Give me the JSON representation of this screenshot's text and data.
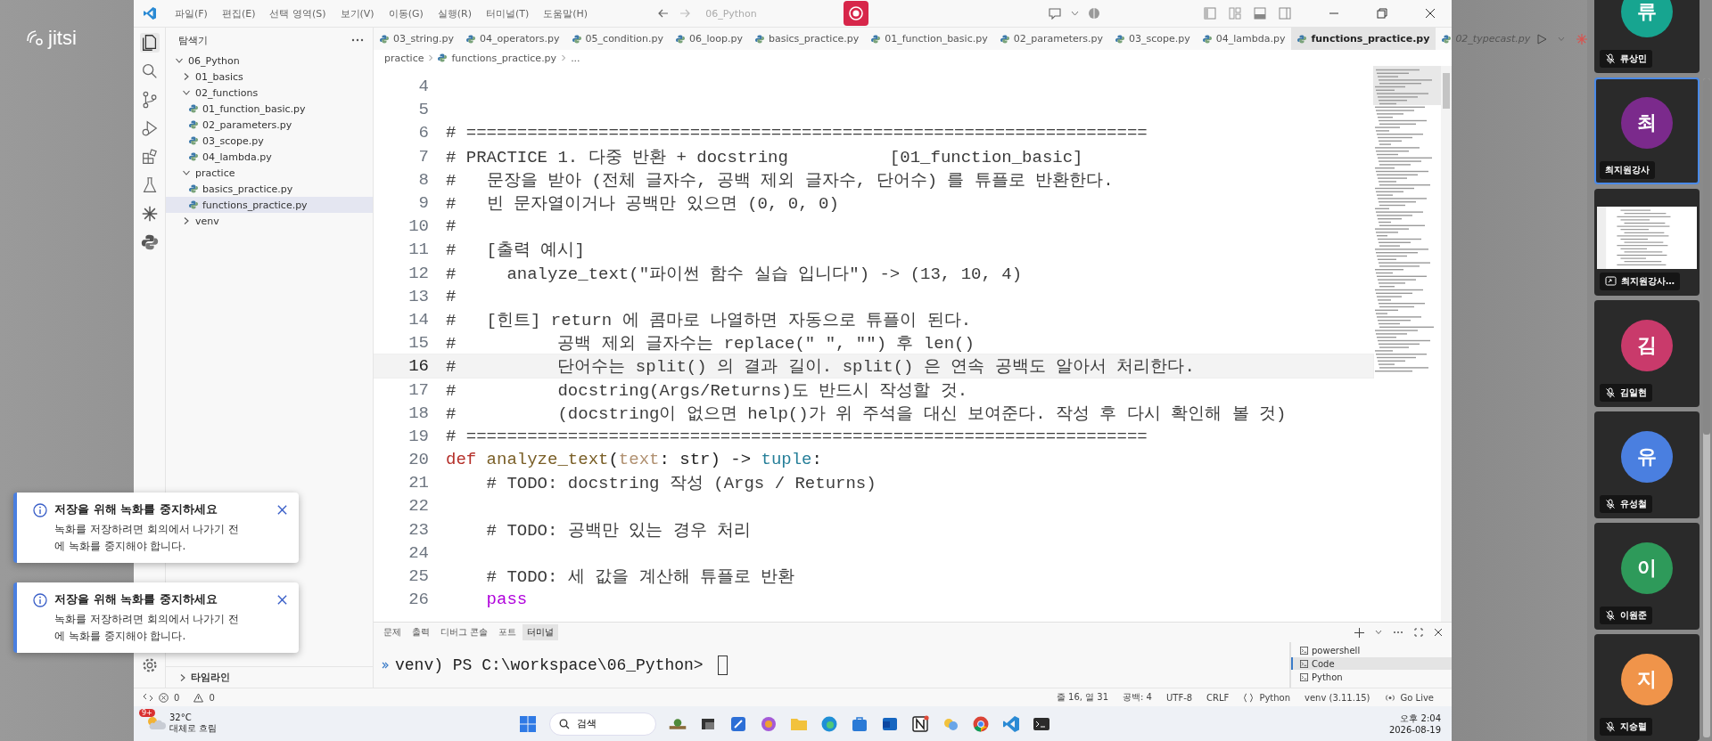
{
  "meeting": {
    "logo": "jitsi"
  },
  "titlebar": {
    "menus": [
      "파일(F)",
      "편집(E)",
      "선택 영역(S)",
      "보기(V)",
      "이동(G)",
      "실행(R)",
      "터미널(T)",
      "도움말(H)"
    ],
    "search": "06_Python"
  },
  "explorer": {
    "title": "탐색기",
    "tree": [
      {
        "label": "06_Python",
        "kind": "folder",
        "expanded": true,
        "selected": false,
        "children": [
          {
            "label": "01_basics",
            "kind": "folder",
            "expanded": false,
            "selected": false
          },
          {
            "label": "02_functions",
            "kind": "folder",
            "expanded": true,
            "selected": false,
            "children": [
              {
                "label": "01_function_basic.py",
                "kind": "file",
                "selected": false
              },
              {
                "label": "02_parameters.py",
                "kind": "file",
                "selected": false
              },
              {
                "label": "03_scope.py",
                "kind": "file",
                "selected": false
              },
              {
                "label": "04_lambda.py",
                "kind": "file",
                "selected": false
              }
            ]
          },
          {
            "label": "practice",
            "kind": "folder",
            "expanded": true,
            "selected": false,
            "children": [
              {
                "label": "basics_practice.py",
                "kind": "file",
                "selected": false
              },
              {
                "label": "functions_practice.py",
                "kind": "file",
                "selected": true
              }
            ]
          },
          {
            "label": "venv",
            "kind": "folder",
            "expanded": false,
            "selected": false
          }
        ]
      }
    ],
    "timeline": "타임라인"
  },
  "tabs": [
    {
      "label": "03_string.py",
      "selected": false,
      "preview": false
    },
    {
      "label": "04_operators.py",
      "selected": false,
      "preview": false
    },
    {
      "label": "05_condition.py",
      "selected": false,
      "preview": false
    },
    {
      "label": "06_loop.py",
      "selected": false,
      "preview": false
    },
    {
      "label": "basics_practice.py",
      "selected": false,
      "preview": false
    },
    {
      "label": "01_function_basic.py",
      "selected": false,
      "preview": false
    },
    {
      "label": "02_parameters.py",
      "selected": false,
      "preview": false
    },
    {
      "label": "03_scope.py",
      "selected": false,
      "preview": false
    },
    {
      "label": "04_lambda.py",
      "selected": false,
      "preview": false
    },
    {
      "label": "functions_practice.py",
      "selected": true,
      "preview": false
    },
    {
      "label": "02_typecast.py",
      "selected": false,
      "preview": true
    }
  ],
  "breadcrumb": [
    "practice",
    "functions_practice.py",
    "..."
  ],
  "code": {
    "lines": [
      {
        "number": "4",
        "current": false
      },
      {
        "number": "5",
        "current": false
      },
      {
        "number": "6",
        "current": false,
        "tokens": [
          {
            "text": "# ===================================================================",
            "kind": "comment"
          }
        ]
      },
      {
        "number": "7",
        "current": false,
        "tokens": [
          {
            "text": "# PRACTICE 1. 다중 반환 + docstring          [01_function_basic]",
            "kind": "comment"
          }
        ]
      },
      {
        "number": "8",
        "current": false,
        "tokens": [
          {
            "text": "#   문장을 받아 (전체 글자수, 공백 제외 글자수, 단어수) 를 튜플로 반환한다.",
            "kind": "comment"
          }
        ]
      },
      {
        "number": "9",
        "current": false,
        "tokens": [
          {
            "text": "#   빈 문자열이거나 공백만 있으면 (0, 0, 0)",
            "kind": "comment"
          }
        ]
      },
      {
        "number": "10",
        "current": false,
        "tokens": [
          {
            "text": "#",
            "kind": "comment"
          }
        ]
      },
      {
        "number": "11",
        "current": false,
        "tokens": [
          {
            "text": "#   [출력 예시]",
            "kind": "comment"
          }
        ]
      },
      {
        "number": "12",
        "current": false,
        "tokens": [
          {
            "text": "#     analyze_text(\"파이썬 함수 실습 입니다\") -> (13, 10, 4)",
            "kind": "comment"
          }
        ]
      },
      {
        "number": "13",
        "current": false,
        "tokens": [
          {
            "text": "#",
            "kind": "comment"
          }
        ]
      },
      {
        "number": "14",
        "current": false,
        "tokens": [
          {
            "text": "#   [힌트] return 에 콤마로 나열하면 자동으로 튜플이 된다.",
            "kind": "comment"
          }
        ]
      },
      {
        "number": "15",
        "current": false,
        "tokens": [
          {
            "text": "#          공백 제외 글자수는 replace(\" \", \"\") 후 len()",
            "kind": "comment"
          }
        ]
      },
      {
        "number": "16",
        "current": true,
        "tokens": [
          {
            "text": "#          단어수는 split() 의 결과 길이. split() 은 연속 공백도 알아서 처리한다.",
            "kind": "comment"
          }
        ]
      },
      {
        "number": "17",
        "current": false,
        "tokens": [
          {
            "text": "#          docstring(Args/Returns)도 반드시 작성할 것.",
            "kind": "comment"
          }
        ]
      },
      {
        "number": "18",
        "current": false,
        "tokens": [
          {
            "text": "#          (docstring이 없으면 help()가 위 주석을 대신 보여준다. 작성 후 다시 확인해 볼 것)",
            "kind": "comment"
          }
        ]
      },
      {
        "number": "19",
        "current": false,
        "tokens": [
          {
            "text": "# ===================================================================",
            "kind": "comment"
          }
        ]
      },
      {
        "number": "20",
        "current": false,
        "tokens": [
          {
            "text": "def ",
            "kind": "keyword"
          },
          {
            "text": "analyze_text",
            "kind": "function"
          },
          {
            "text": "(",
            "kind": "plain"
          },
          {
            "text": "text",
            "kind": "param"
          },
          {
            "text": ": str) -> ",
            "kind": "plain"
          },
          {
            "text": "tuple",
            "kind": "type"
          },
          {
            "text": ":",
            "kind": "plain"
          }
        ]
      },
      {
        "number": "21",
        "current": false,
        "tokens": [
          {
            "text": "    # TODO: docstring 작성 (Args / Returns)",
            "kind": "comment"
          }
        ]
      },
      {
        "number": "22",
        "current": false
      },
      {
        "number": "23",
        "current": false,
        "tokens": [
          {
            "text": "    # TODO: 공백만 있는 경우 처리",
            "kind": "comment"
          }
        ]
      },
      {
        "number": "24",
        "current": false
      },
      {
        "number": "25",
        "current": false,
        "tokens": [
          {
            "text": "    # TODO: 세 값을 계산해 튜플로 반환",
            "kind": "comment"
          }
        ]
      },
      {
        "number": "26",
        "current": false,
        "tokens": [
          {
            "text": "    pass",
            "kind": "control"
          }
        ]
      }
    ]
  },
  "panel": {
    "tabs": [
      {
        "label": "문제",
        "selected": false
      },
      {
        "label": "출력",
        "selected": false
      },
      {
        "label": "디버그 콘솔",
        "selected": false
      },
      {
        "label": "포트",
        "selected": false
      },
      {
        "label": "터미널",
        "selected": true
      }
    ],
    "prompt": "venv) PS C:\\workspace\\06_Python> ",
    "terminals": [
      {
        "label": "powershell",
        "selected": false
      },
      {
        "label": "Code",
        "selected": true
      },
      {
        "label": "Python",
        "selected": false
      }
    ]
  },
  "status_bar": {
    "errors": "0",
    "warnings": "0",
    "items": [
      {
        "text": "줄 16, 열 31",
        "kind": "plain"
      },
      {
        "text": "공백: 4",
        "kind": "plain"
      },
      {
        "text": "UTF-8",
        "kind": "plain"
      },
      {
        "text": "CRLF",
        "kind": "plain"
      },
      {
        "text": "Python",
        "kind": "language"
      },
      {
        "text": "venv (3.11.15)",
        "kind": "plain"
      },
      {
        "text": "Go Live",
        "kind": "live"
      }
    ]
  },
  "taskbar": {
    "weather": {
      "badge": "9+",
      "temp": "32°C",
      "desc": "대체로 흐림"
    },
    "search": "검색",
    "time": "오후 2:04",
    "date": "2026-08-19"
  },
  "notifications": [
    {
      "title": "저장을 위해 녹화를 중지하세요",
      "body": "녹화를 저장하려면 회의에서 나가기 전에 녹화를 중지해야 합니다."
    },
    {
      "title": "저장을 위해 녹화를 중지하세요",
      "body": "녹화를 저장하려면 회의에서 나가기 전에 녹화를 중지해야 합니다."
    }
  ],
  "participants": [
    {
      "name": "류상민",
      "initial": "류",
      "color": "#17a590",
      "kind": "avatar",
      "muted": true,
      "selected": false
    },
    {
      "name": "최지원강사",
      "initial": "최",
      "color": "#7b2a8c",
      "kind": "avatar",
      "muted": false,
      "selected": true
    },
    {
      "name": "최지원강사…",
      "kind": "screen",
      "muted": false,
      "selected": false
    },
    {
      "name": "김일현",
      "initial": "김",
      "color": "#c93a6b",
      "kind": "avatar",
      "muted": true,
      "selected": false
    },
    {
      "name": "유성철",
      "initial": "유",
      "color": "#4a7fe0",
      "kind": "avatar",
      "muted": true,
      "selected": false
    },
    {
      "name": "이원준",
      "initial": "이",
      "color": "#2e9a5a",
      "kind": "avatar",
      "muted": true,
      "selected": false
    },
    {
      "name": "지승렬",
      "initial": "지",
      "color": "#f0944a",
      "kind": "avatar",
      "muted": true,
      "selected": false
    }
  ]
}
